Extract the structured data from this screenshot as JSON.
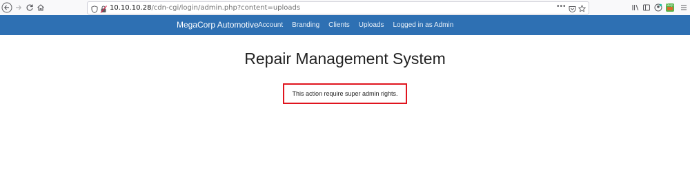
{
  "browser": {
    "url_host": "10.10.10.28",
    "url_path": "/cdn-cgi/login/admin.php?content=uploads",
    "icons": [
      "back-icon",
      "forward-icon",
      "reload-icon",
      "home-icon",
      "shield-icon",
      "insecure-lock-icon",
      "page-actions-icon",
      "pocket-icon",
      "bookmark-star-icon",
      "library-icon",
      "sidebar-icon",
      "account-icon",
      "extension-icon",
      "menu-icon"
    ]
  },
  "nav": {
    "brand": "MegaCorp Automotive",
    "items": [
      "Account",
      "Branding",
      "Clients",
      "Uploads",
      "Logged in as Admin"
    ]
  },
  "main": {
    "title": "Repair Management System",
    "alert": "This action require super admin rights."
  },
  "colors": {
    "navbar": "#2e70b3",
    "alert_border": "#e0141e"
  }
}
